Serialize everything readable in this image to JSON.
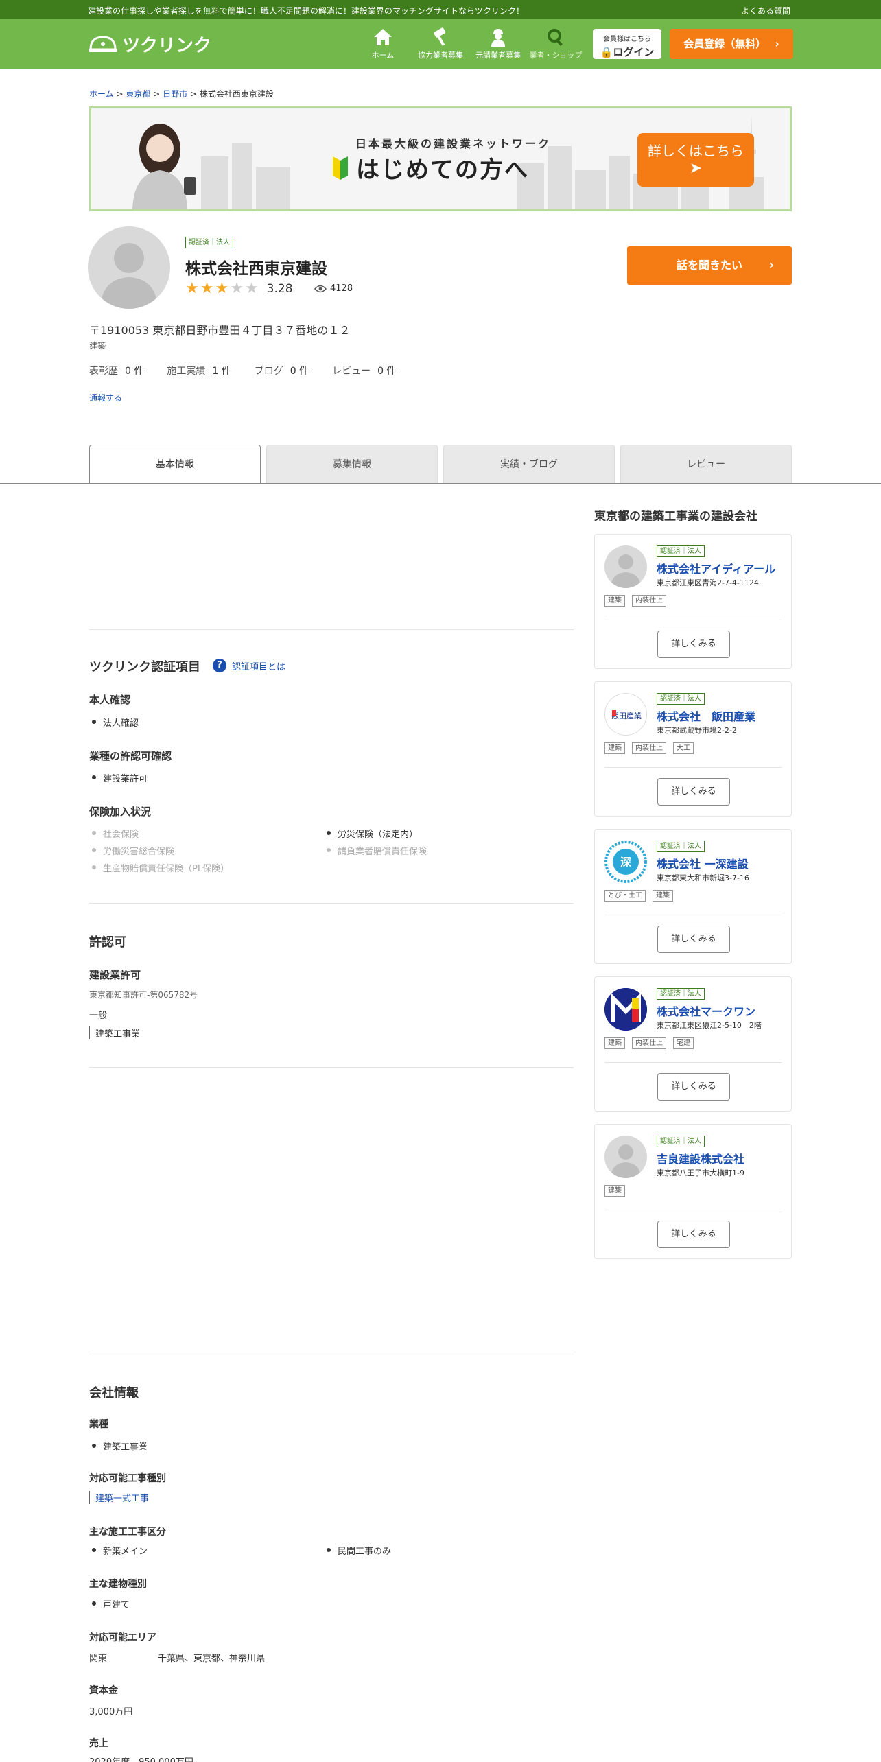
{
  "topbar": {
    "message": "建設業の仕事探しや業者探しを無料で簡単に！職人不足問題の解消に！建設業界のマッチングサイトならツクリンク！",
    "faq": "よくある質問"
  },
  "header": {
    "logo_text": "ツクリンク",
    "nav": [
      {
        "label": "ホーム",
        "icon": "home-icon"
      },
      {
        "label": "協力業者募集",
        "icon": "hammer-icon"
      },
      {
        "label": "元請業者募集",
        "icon": "worker-icon"
      },
      {
        "label": "業者・ショップ",
        "icon": "search-icon"
      }
    ],
    "login_small": "会員様はこちら",
    "login_label": "ログイン",
    "register_label": "会員登録（無料）"
  },
  "breadcrumb": {
    "items": [
      "ホーム",
      "東京都",
      "日野市"
    ],
    "current": "株式会社西東京建設",
    "sep": ">"
  },
  "banner": {
    "tagline": "日本最大級の建設業ネットワーク",
    "headline": "はじめての方へ",
    "cta": "詳しくはこちら"
  },
  "profile": {
    "cert_badge": "認証済｜法人",
    "company_name": "株式会社西東京建設",
    "rating": 3.28,
    "rating_text": "3.28",
    "rating_color": "#f5a623",
    "views": "4128",
    "talk_button": "話を聞きたい",
    "address": "〒1910053 東京都日野市豊田４丁目３７番地の１２",
    "category": "建築",
    "stats": [
      {
        "label": "表彰歴",
        "value": "0 件"
      },
      {
        "label": "施工実績",
        "value": "1 件"
      },
      {
        "label": "ブログ",
        "value": "0 件"
      },
      {
        "label": "レビュー",
        "value": "0 件"
      }
    ],
    "report_link": "通報する"
  },
  "tabs": [
    "基本情報",
    "募集情報",
    "実績・ブログ",
    "レビュー"
  ],
  "certification": {
    "title": "ツクリンク認証項目",
    "help_link": "認証項目とは",
    "identity_title": "本人確認",
    "identity_items": [
      "法人確認"
    ],
    "permit_title": "業種の許認可確認",
    "permit_items": [
      "建設業許可"
    ],
    "insurance_title": "保険加入状況",
    "insurance_left": [
      "社会保険",
      "労働災害総合保険",
      "生産物賠償責任保険（PL保険）"
    ],
    "insurance_right": [
      "労災保険（法定内）",
      "請負業者賠償責任保険"
    ]
  },
  "license": {
    "title": "許認可",
    "sub_title": "建設業許可",
    "number": "東京都知事許可-第065782号",
    "type": "一般",
    "work": "建築工事業"
  },
  "company_info": {
    "title": "会社情報",
    "business_title": "業種",
    "business_items": [
      "建築工事業"
    ],
    "work_types_title": "対応可能工事種別",
    "work_types": "建築一式工事",
    "construction_class_title": "主な施工工事区分",
    "construction_class_left": "新築メイン",
    "construction_class_right": "民間工事のみ",
    "building_type_title": "主な建物種別",
    "building_types": [
      "戸建て"
    ],
    "area_title": "対応可能エリア",
    "area_region": "関東",
    "area_prefs": "千葉県、東京都、神奈川県",
    "capital_title": "資本金",
    "capital": "3,000万円",
    "sales_title": "売上",
    "sales": "2020年度　950,000万円"
  },
  "sidebar": {
    "title": "東京都の建築工事業の建設会社",
    "more_label": "詳しくみる",
    "cards": [
      {
        "cert": "認証済｜法人",
        "name": "株式会社アイディアール",
        "address": "東京都江東区青海2-7-4-1124",
        "tags": [
          "建築",
          "内装仕上"
        ],
        "logo": "avatar-placeholder"
      },
      {
        "cert": "認証済｜法人",
        "name": "株式会社　飯田産業",
        "address": "東京都武蔵野市境2-2-2",
        "tags": [
          "建築",
          "内装仕上",
          "大工"
        ],
        "logo": "iida-logo"
      },
      {
        "cert": "認証済｜法人",
        "name": "株式会社 一深建設",
        "address": "東京都東大和市新堀3-7-16",
        "tags": [
          "とび・土工",
          "建築"
        ],
        "logo": "ichishin-logo"
      },
      {
        "cert": "認証済｜法人",
        "name": "株式会社マークワン",
        "address": "東京都江東区猿江2-5-10　2階",
        "tags": [
          "建築",
          "内装仕上",
          "宅建"
        ],
        "logo": "markone-logo"
      },
      {
        "cert": "認証済｜法人",
        "name": "吉良建設株式会社",
        "address": "東京都八王子市大横町1-9",
        "tags": [
          "建築"
        ],
        "logo": "avatar-placeholder"
      }
    ]
  },
  "colors": {
    "brand_green": "#72b84b",
    "dark_green": "#3f7c1c",
    "accent_orange": "#f57c14",
    "link_blue": "#1a4fb0"
  }
}
